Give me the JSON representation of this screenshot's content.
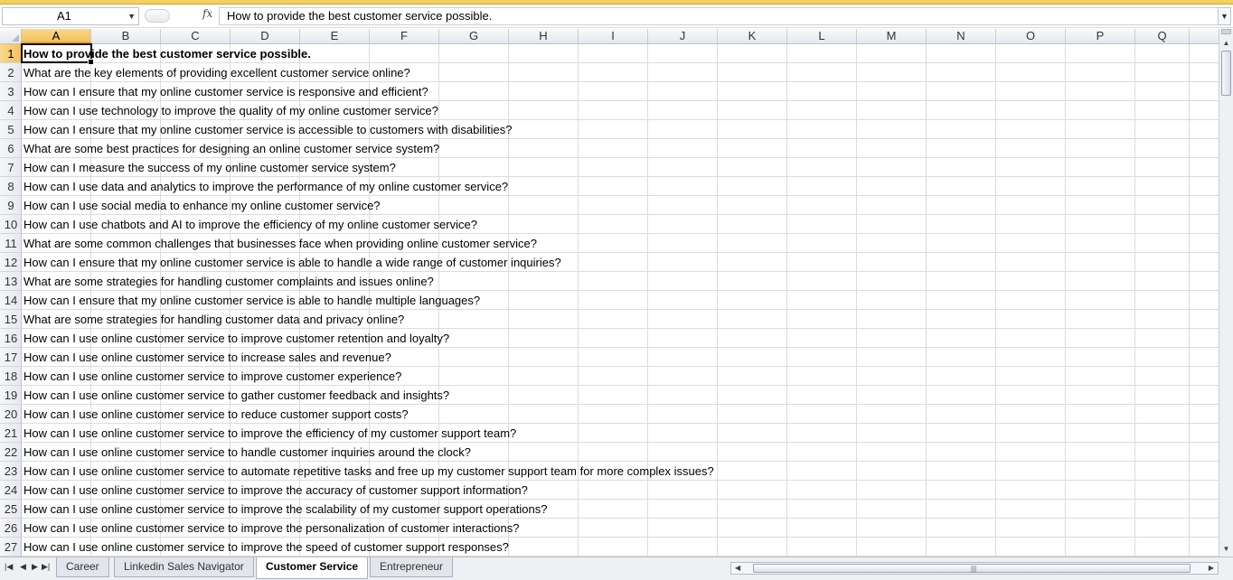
{
  "formula_bar": {
    "name_box": "A1",
    "fx_label": "fx",
    "content": "How to provide the best customer service possible."
  },
  "columns": [
    "A",
    "B",
    "C",
    "D",
    "E",
    "F",
    "G",
    "H",
    "I",
    "J",
    "K",
    "L",
    "M",
    "N",
    "O",
    "P",
    "Q"
  ],
  "selected_column": "A",
  "selected_row": 1,
  "rows": [
    {
      "n": "1",
      "text": "How to provide the best customer service possible."
    },
    {
      "n": "2",
      "text": "What are the key elements of providing excellent customer service online?"
    },
    {
      "n": "3",
      "text": "How can I ensure that my online customer service is responsive and efficient?"
    },
    {
      "n": "4",
      "text": "How can I use technology to improve the quality of my online customer service?"
    },
    {
      "n": "5",
      "text": "How can I ensure that my online customer service is accessible to customers with disabilities?"
    },
    {
      "n": "6",
      "text": "What are some best practices for designing an online customer service system?"
    },
    {
      "n": "7",
      "text": "How can I measure the success of my online customer service system?"
    },
    {
      "n": "8",
      "text": "How can I use data and analytics to improve the performance of my online customer service?"
    },
    {
      "n": "9",
      "text": "How can I use social media to enhance my online customer service?"
    },
    {
      "n": "10",
      "text": "How can I use chatbots and AI to improve the efficiency of my online customer service?"
    },
    {
      "n": "11",
      "text": "What are some common challenges that businesses face when providing online customer service?"
    },
    {
      "n": "12",
      "text": "How can I ensure that my online customer service is able to handle a wide range of customer inquiries?"
    },
    {
      "n": "13",
      "text": "What are some strategies for handling customer complaints and issues online?"
    },
    {
      "n": "14",
      "text": "How can I ensure that my online customer service is able to handle multiple languages?"
    },
    {
      "n": "15",
      "text": "What are some strategies for handling customer data and privacy online?"
    },
    {
      "n": "16",
      "text": "How can I use online customer service to improve customer retention and loyalty?"
    },
    {
      "n": "17",
      "text": "How can I use online customer service to increase sales and revenue?"
    },
    {
      "n": "18",
      "text": "How can I use online customer service to improve customer experience?"
    },
    {
      "n": "19",
      "text": "How can I use online customer service to gather customer feedback and insights?"
    },
    {
      "n": "20",
      "text": "How can I use online customer service to reduce customer support costs?"
    },
    {
      "n": "21",
      "text": "How can I use online customer service to improve the efficiency of my customer support team?"
    },
    {
      "n": "22",
      "text": "How can I use online customer service to handle customer inquiries around the clock?"
    },
    {
      "n": "23",
      "text": "How can I use online customer service to automate repetitive tasks and free up my customer support team for more complex issues?"
    },
    {
      "n": "24",
      "text": "How can I use online customer service to improve the accuracy of customer support information?"
    },
    {
      "n": "25",
      "text": "How can I use online customer service to improve the scalability of my customer support operations?"
    },
    {
      "n": "26",
      "text": "How can I use online customer service to improve the personalization of customer interactions?"
    },
    {
      "n": "27",
      "text": "How can I use online customer service to improve the speed of customer support responses?"
    }
  ],
  "sheet_tabs": [
    "Career",
    "Linkedin Sales Navigator",
    "Customer Service",
    "Entrepreneur"
  ],
  "active_tab": "Customer Service",
  "icons": {
    "first_sheet": "first-sheet-icon",
    "prev_sheet": "prev-sheet-icon",
    "next_sheet": "next-sheet-icon",
    "last_sheet": "last-sheet-icon"
  }
}
